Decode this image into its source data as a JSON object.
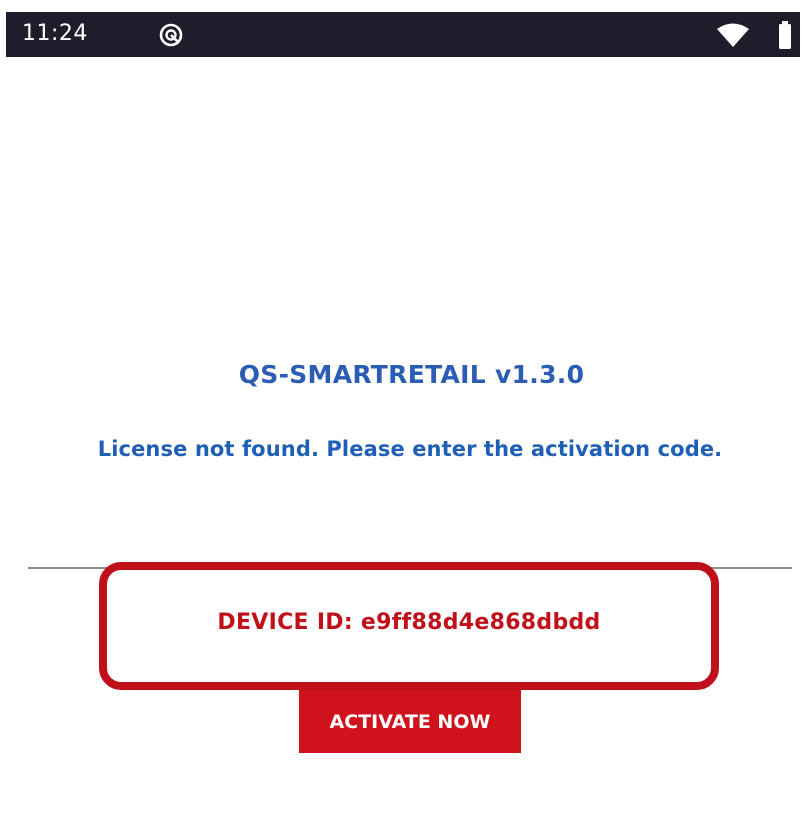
{
  "status_bar": {
    "time": "11:24",
    "icons": [
      "notification-icon",
      "wifi-icon",
      "battery-icon"
    ]
  },
  "app": {
    "title": "QS-SMARTRETAIL v1.3.0",
    "license_message": "License not found. Please enter the activation code.",
    "device_id_label": "DEVICE ID: e9ff88d4e868dbdd",
    "activate_button_label": "ACTIVATE NOW"
  },
  "colors": {
    "status_bar_bg": "#1f1c2c",
    "title_blue": "#2a5db3",
    "accent_red": "#c0101a",
    "button_red": "#d0121c"
  }
}
